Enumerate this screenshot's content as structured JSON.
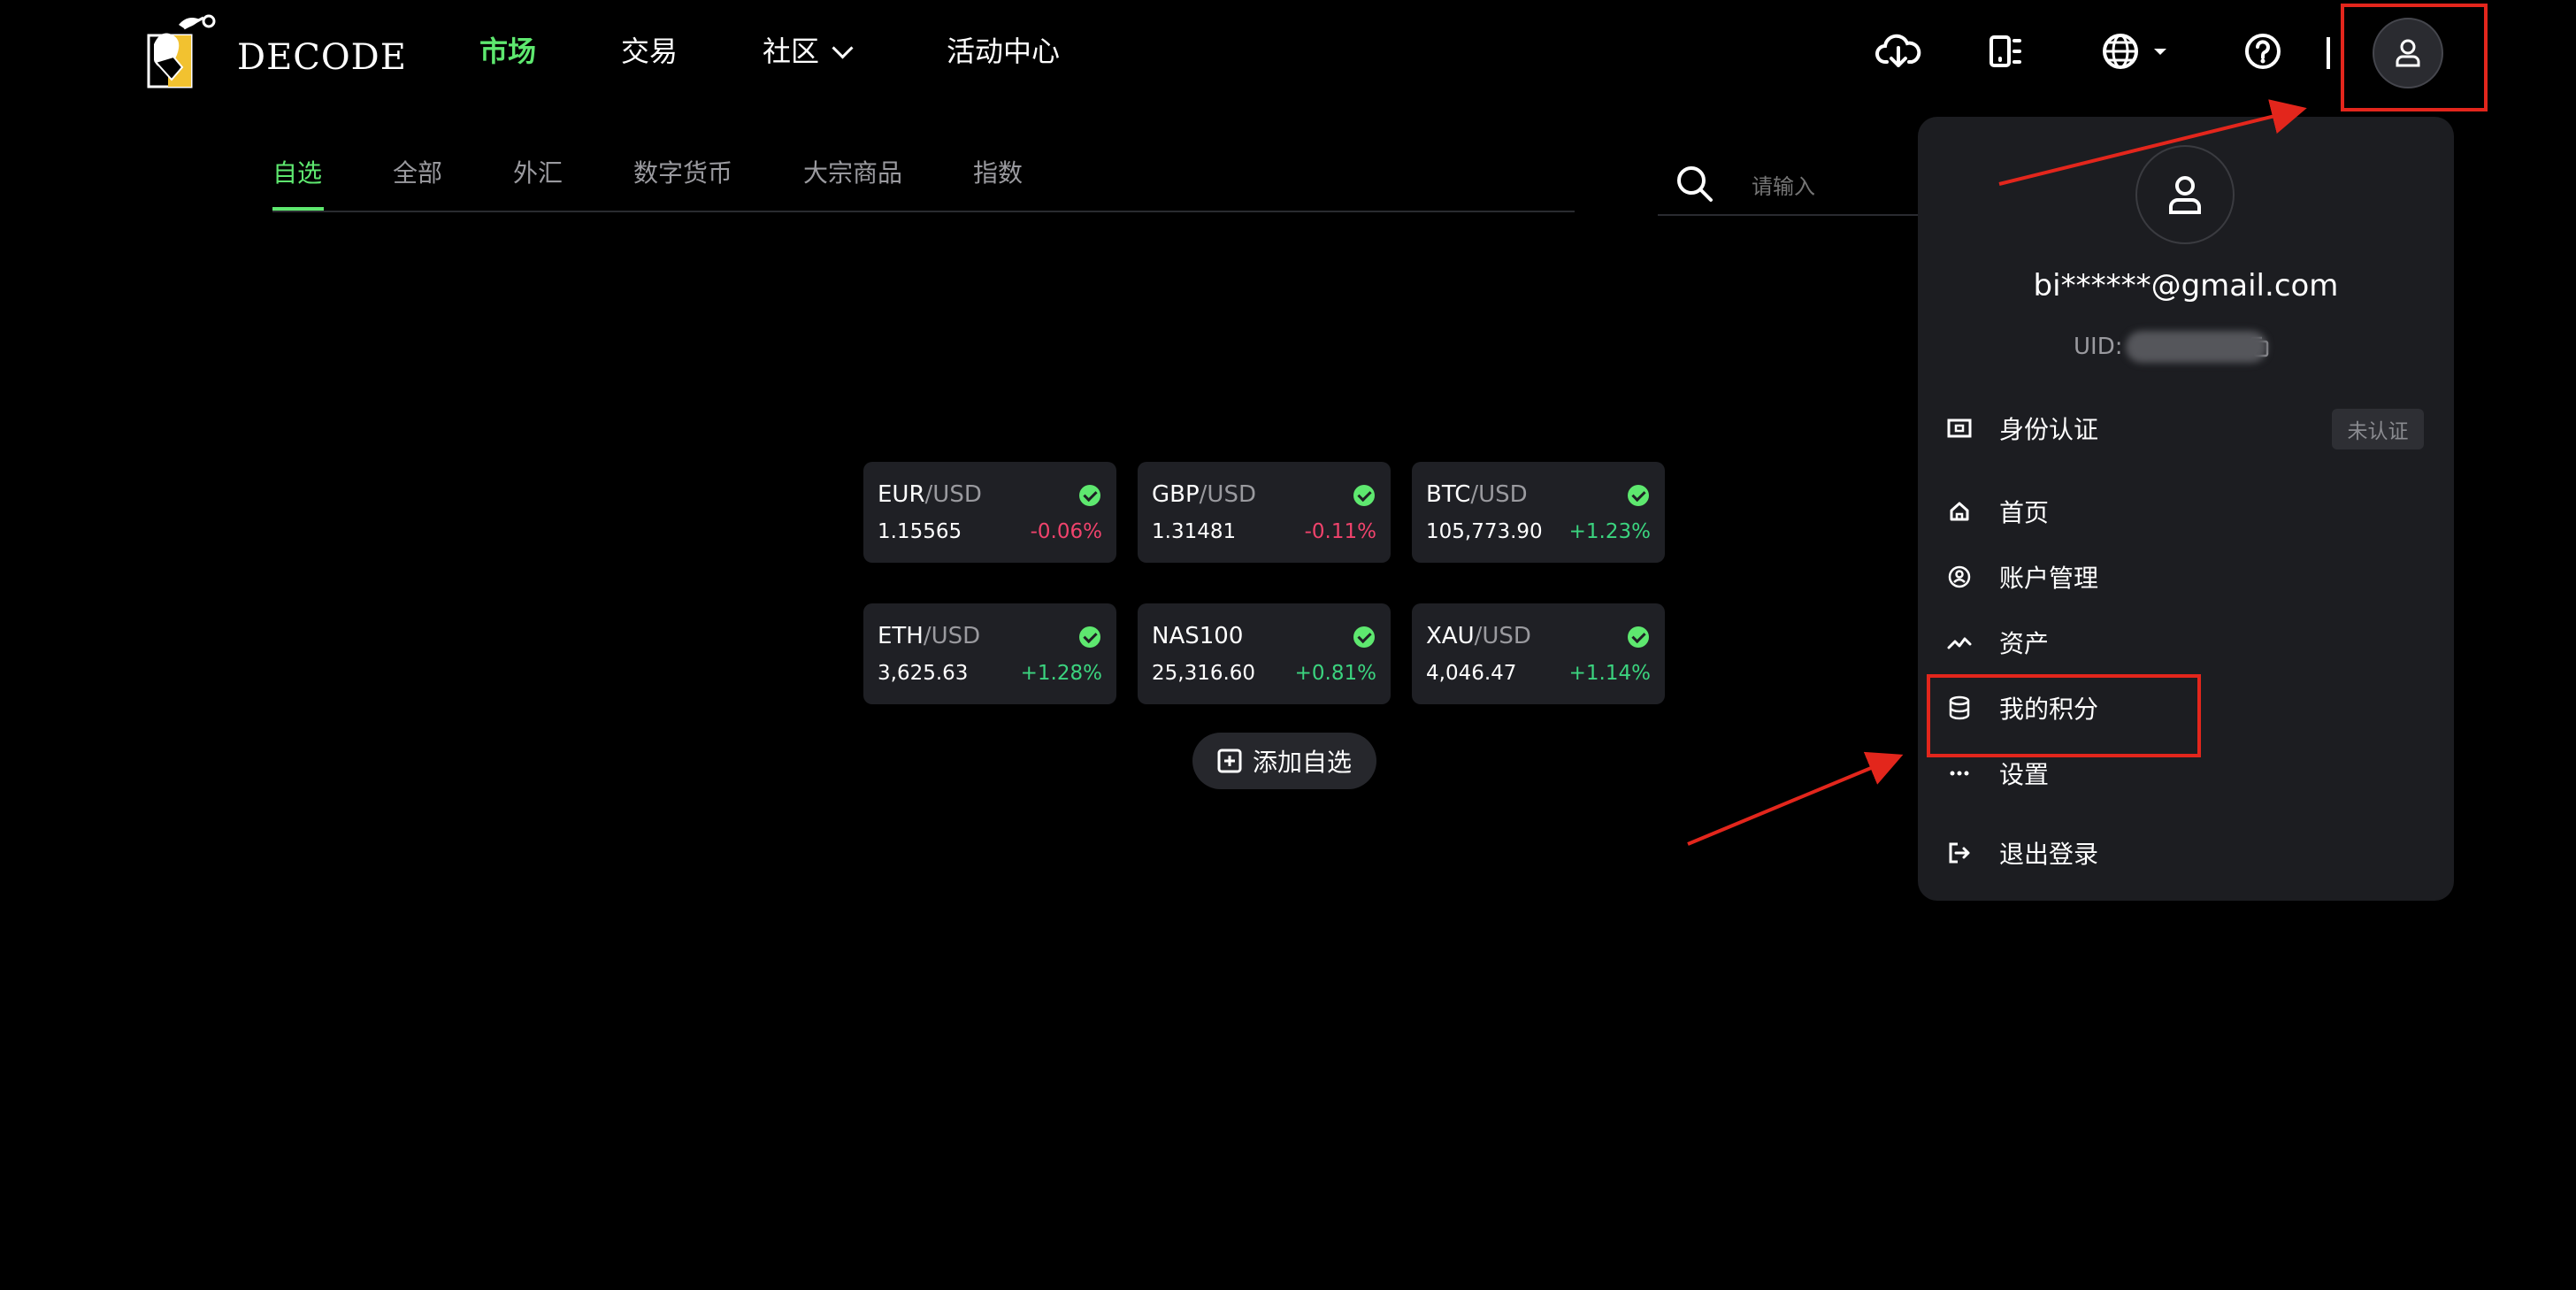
{
  "brand": {
    "name": "DECODE"
  },
  "nav": {
    "market": "市场",
    "trade": "交易",
    "community": "社区",
    "events": "活动中心"
  },
  "header_icons": [
    "cloud-download-icon",
    "mobile-app-icon",
    "globe-icon",
    "help-icon",
    "user-icon"
  ],
  "tabs": [
    {
      "label": "自选",
      "active": true
    },
    {
      "label": "全部"
    },
    {
      "label": "外汇"
    },
    {
      "label": "数字货币"
    },
    {
      "label": "大宗商品"
    },
    {
      "label": "指数"
    }
  ],
  "search": {
    "placeholder": "请输入"
  },
  "watchlist": [
    {
      "base": "EUR",
      "quote": "/USD",
      "price": "1.15565",
      "change": "-0.06%",
      "direction": "down"
    },
    {
      "base": "GBP",
      "quote": "/USD",
      "price": "1.31481",
      "change": "-0.11%",
      "direction": "down"
    },
    {
      "base": "BTC",
      "quote": "/USD",
      "price": "105,773.90",
      "change": "+1.23%",
      "direction": "up"
    },
    {
      "base": "ETH",
      "quote": "/USD",
      "price": "3,625.63",
      "change": "+1.28%",
      "direction": "up"
    },
    {
      "base": "NAS100",
      "quote": "",
      "price": "25,316.60",
      "change": "+0.81%",
      "direction": "up"
    },
    {
      "base": "XAU",
      "quote": "/USD",
      "price": "4,046.47",
      "change": "+1.14%",
      "direction": "up"
    }
  ],
  "add_watchlist": "添加自选",
  "user_menu": {
    "email": "bi******@gmail.com",
    "uid_label": "UID:",
    "verification": {
      "label": "身份认证",
      "badge": "未认证"
    },
    "items": [
      {
        "label": "首页",
        "icon": "home-icon"
      },
      {
        "label": "账户管理",
        "icon": "account-icon"
      },
      {
        "label": "资产",
        "icon": "chart-line-icon"
      },
      {
        "label": "我的积分",
        "icon": "coins-icon"
      },
      {
        "label": "设置",
        "icon": "more-icon"
      }
    ],
    "logout": "退出登录"
  },
  "colors": {
    "accent_green": "#5ee86f",
    "up": "#3bd47f",
    "down": "#f0436c",
    "annotation_red": "#e3261c",
    "panel": "#1c1d21"
  }
}
